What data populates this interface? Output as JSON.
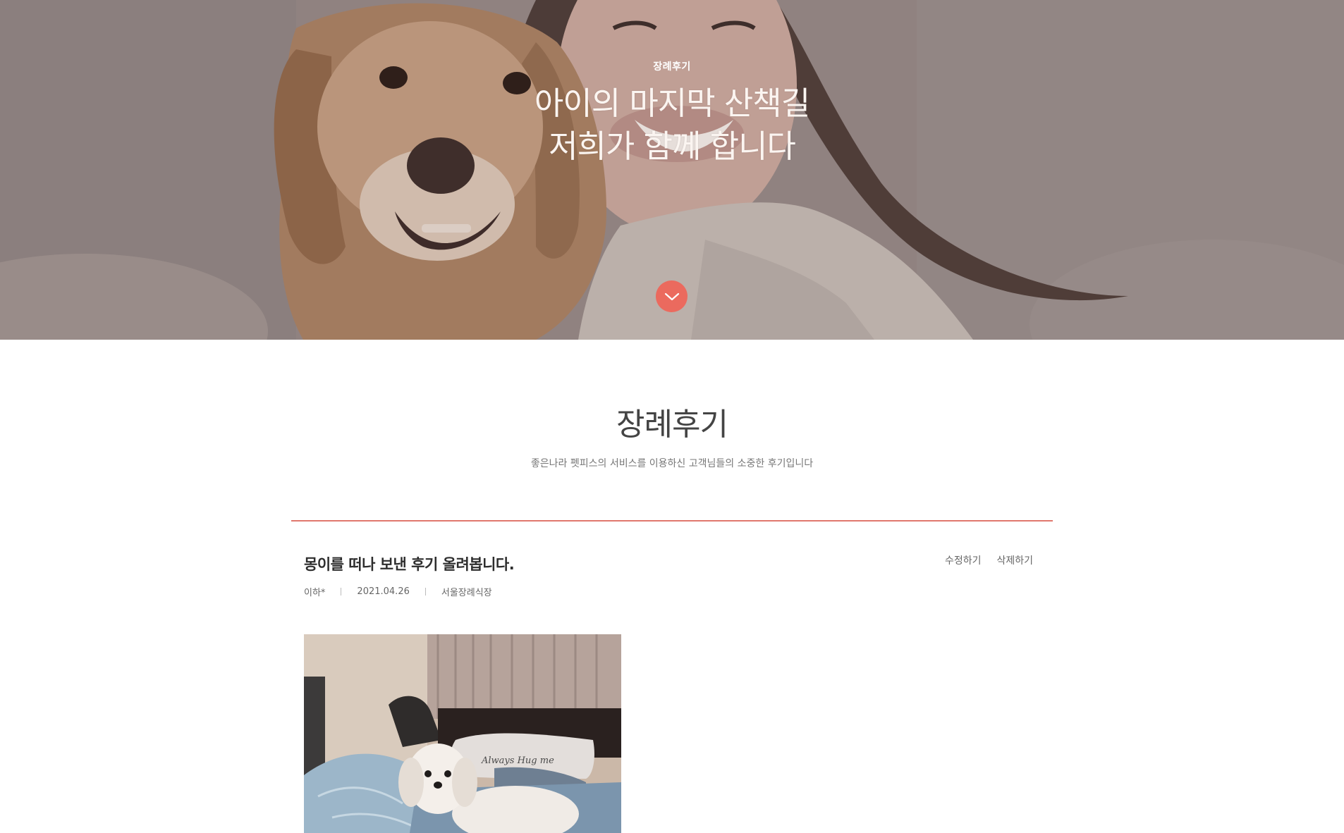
{
  "hero": {
    "eyebrow": "장례후기",
    "title_line1": "아이의 마지막 산책길",
    "title_line2": "저희가 함께 합니다",
    "accent_color": "#eb6a5e"
  },
  "section": {
    "title": "장례후기",
    "description": "좋은나라 펫피스의 서비스를 이용하신 고객님들의 소중한 후기입니다",
    "divider_color": "#e0776d"
  },
  "post": {
    "title": "몽이를 떠나 보낸 후기 올려봅니다.",
    "actions": {
      "edit": "수정하기",
      "delete": "삭제하기"
    },
    "meta": {
      "author": "이하*",
      "date": "2021.04.26",
      "location": "서울장례식장"
    },
    "image": {
      "pillow_text": "Always Hug me"
    }
  },
  "icons": {
    "scroll_down": "chevron-down-icon"
  }
}
